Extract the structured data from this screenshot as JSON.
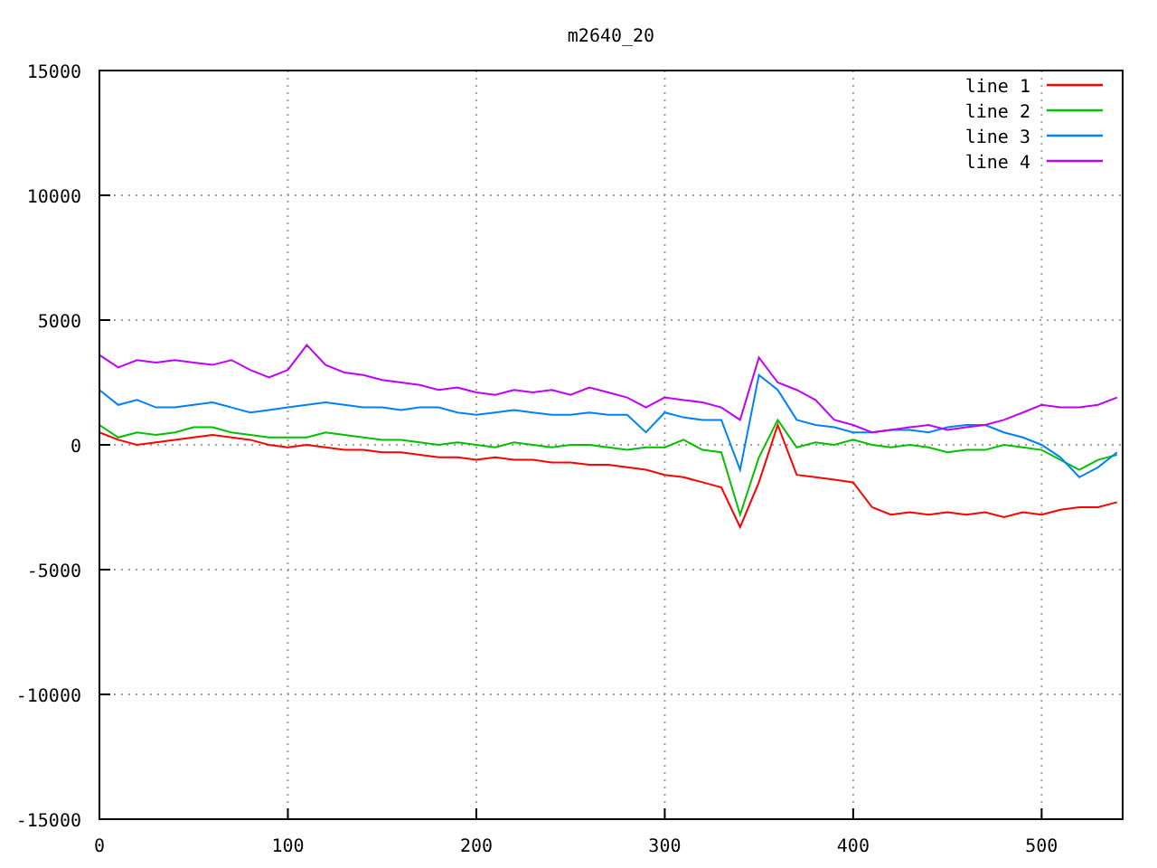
{
  "chart_data": {
    "type": "line",
    "title": "m2640_20",
    "x": [
      0,
      10,
      20,
      30,
      40,
      50,
      60,
      70,
      80,
      90,
      100,
      110,
      120,
      130,
      140,
      150,
      160,
      170,
      180,
      190,
      200,
      210,
      220,
      230,
      240,
      250,
      260,
      270,
      280,
      290,
      300,
      310,
      320,
      330,
      340,
      350,
      360,
      370,
      380,
      390,
      400,
      410,
      420,
      430,
      440,
      450,
      460,
      470,
      480,
      490,
      500,
      510,
      520,
      530,
      540
    ],
    "series": [
      {
        "name": "line 1",
        "color": "#ff0000",
        "values": [
          500,
          200,
          0,
          100,
          200,
          300,
          400,
          300,
          200,
          0,
          -100,
          0,
          -100,
          -200,
          -200,
          -300,
          -300,
          -400,
          -500,
          -500,
          -600,
          -500,
          -600,
          -600,
          -700,
          -700,
          -800,
          -800,
          -900,
          -1000,
          -1200,
          -1300,
          -1500,
          -1700,
          -3300,
          -1500,
          800,
          -1200,
          -1300,
          -1400,
          -1500,
          -2500,
          -2800,
          -2700,
          -2800,
          -2700,
          -2800,
          -2700,
          -2900,
          -2700,
          -2800,
          -2600,
          -2500,
          -2500,
          -2300
        ]
      },
      {
        "name": "line 2",
        "color": "#00c000",
        "values": [
          800,
          300,
          500,
          400,
          500,
          700,
          700,
          500,
          400,
          300,
          300,
          300,
          500,
          400,
          300,
          200,
          200,
          100,
          0,
          100,
          0,
          -100,
          100,
          0,
          -100,
          0,
          0,
          -100,
          -200,
          -100,
          -100,
          200,
          -200,
          -300,
          -2800,
          -500,
          1000,
          -100,
          100,
          0,
          200,
          0,
          -100,
          0,
          -100,
          -300,
          -200,
          -200,
          0,
          -100,
          -200,
          -600,
          -1000,
          -600,
          -400
        ]
      },
      {
        "name": "line 3",
        "color": "#0080ff",
        "values": [
          2200,
          1600,
          1800,
          1500,
          1500,
          1600,
          1700,
          1500,
          1300,
          1400,
          1500,
          1600,
          1700,
          1600,
          1500,
          1500,
          1400,
          1500,
          1500,
          1300,
          1200,
          1300,
          1400,
          1300,
          1200,
          1200,
          1300,
          1200,
          1200,
          500,
          1300,
          1100,
          1000,
          1000,
          -1000,
          2800,
          2200,
          1000,
          800,
          700,
          500,
          500,
          600,
          600,
          500,
          700,
          800,
          800,
          500,
          300,
          0,
          -500,
          -1300,
          -900,
          -300
        ]
      },
      {
        "name": "line 4",
        "color": "#c000ff",
        "values": [
          3600,
          3100,
          3400,
          3300,
          3400,
          3300,
          3200,
          3400,
          3000,
          2700,
          3000,
          4000,
          3200,
          2900,
          2800,
          2600,
          2500,
          2400,
          2200,
          2300,
          2100,
          2000,
          2200,
          2100,
          2200,
          2000,
          2300,
          2100,
          1900,
          1500,
          1900,
          1800,
          1700,
          1500,
          1000,
          3500,
          2500,
          2200,
          1800,
          1000,
          800,
          500,
          600,
          700,
          800,
          600,
          700,
          800,
          1000,
          1300,
          1600,
          1500,
          1500,
          1600,
          1900
        ]
      }
    ],
    "xlim": [
      0,
      543
    ],
    "ylim": [
      -15000,
      15000
    ],
    "xticks": [
      0,
      100,
      200,
      300,
      400,
      500
    ],
    "yticks": [
      -15000,
      -10000,
      -5000,
      0,
      5000,
      10000,
      15000
    ],
    "grid": true,
    "legend": true
  }
}
